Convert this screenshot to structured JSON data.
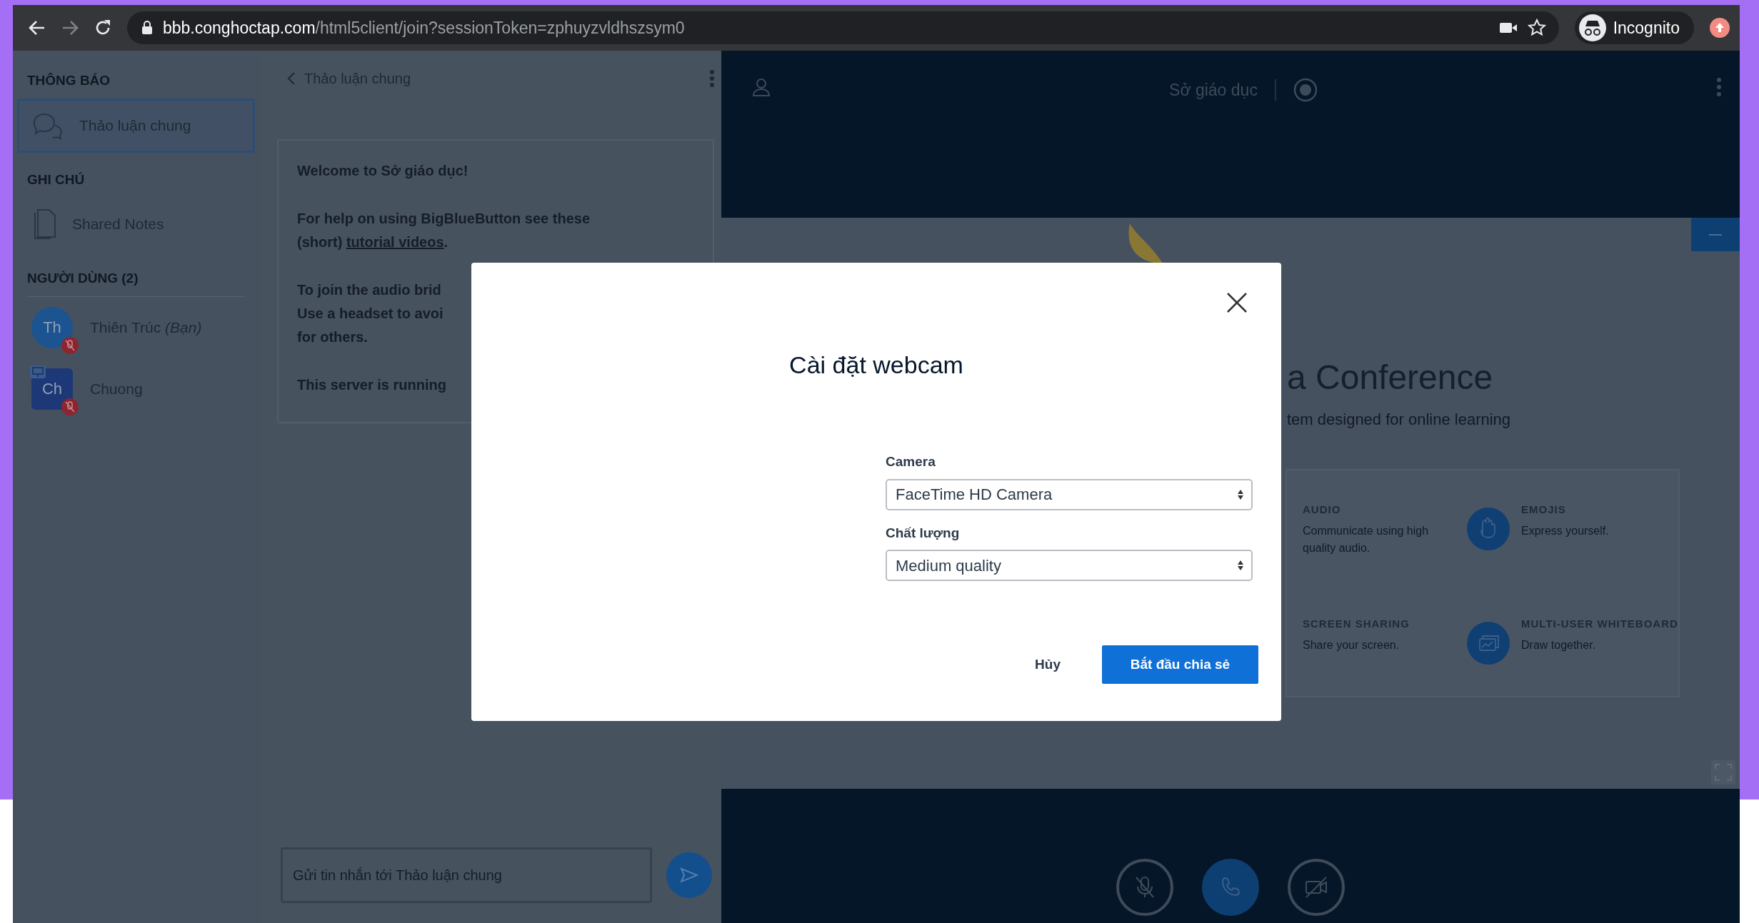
{
  "browser": {
    "url_host": "bbb.conghoctap.com",
    "url_path": "/html5client/join?sessionToken=zphuyzvldhszsym0",
    "profile": "Incognito"
  },
  "sidebar": {
    "sections": [
      {
        "heading": "THÔNG BÁO",
        "items": [
          {
            "kind": "chat",
            "label": "Thảo luận chung",
            "selected": true
          }
        ]
      },
      {
        "heading": "GHI CHÚ",
        "items": [
          {
            "kind": "notes",
            "label": "Shared Notes",
            "selected": false
          }
        ]
      }
    ],
    "users": {
      "heading": "NGƯỜI DÙNG (2)",
      "items": [
        {
          "initials": "Th",
          "name": "Thiên Trúc *(Bạn)*",
          "kind": "viewer",
          "color": "#1b5490",
          "presenter": false,
          "muted": true
        },
        {
          "initials": "Ch",
          "name": "Chuong",
          "kind": "moderator",
          "color": "#1d3877",
          "presenter": true,
          "muted": true
        }
      ]
    }
  },
  "chat": {
    "title": "Thảo luận chung",
    "paragraphs": [
      {
        "lines": [
          "Welcome to **Sở giáo dục**!"
        ]
      },
      {
        "lines": [
          "For help on using BigBlueButton see these",
          "(short) "
        ],
        "link": "tutorial videos",
        "after": "."
      },
      {
        "lines": [
          "To join the audio brid",
          "Use a headset to avoi",
          "for others."
        ]
      },
      {
        "lines": [
          "This server is running"
        ]
      }
    ],
    "input": {
      "placeholder": "Gửi tin nhắn tới Thảo luận chung"
    }
  },
  "meeting": {
    "title": "Sở giáo dục",
    "slide": {
      "heading": "a Conference",
      "subheading": "tem designed for online learning",
      "features": [
        {
          "title": "AUDIO",
          "description": "Communicate using high quality audio.",
          "icon_visible": false
        },
        {
          "title": "EMOJIS",
          "description": "Express yourself.",
          "icon_visible": true
        },
        {
          "title": "SCREEN SHARING",
          "description": "Share your screen.",
          "icon_visible": false
        },
        {
          "title": "MULTI-USER WHITEBOARD",
          "description": "Draw together.",
          "icon_visible": true
        }
      ]
    }
  },
  "modal": {
    "title": "Cài đặt webcam",
    "fields": [
      {
        "label": "Camera",
        "value": "FaceTime HD Camera"
      },
      {
        "label": "Chất lượng",
        "value": "Medium quality"
      }
    ],
    "buttons": [
      {
        "kind": "secondary",
        "label": "Hủy"
      },
      {
        "kind": "primary",
        "label": "Bắt đầu chia sẻ"
      }
    ]
  }
}
